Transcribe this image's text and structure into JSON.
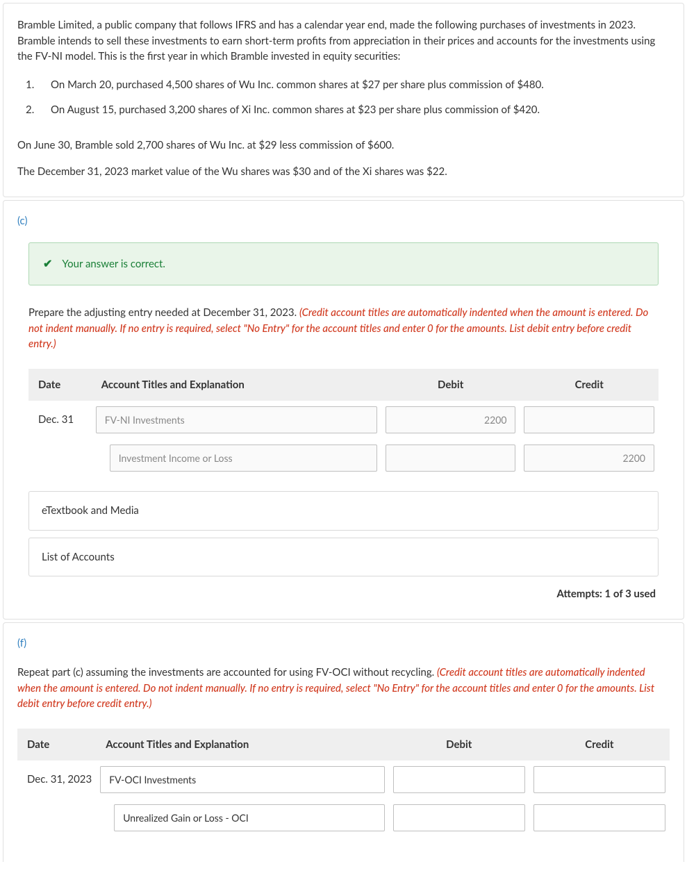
{
  "intro": {
    "p1": "Bramble Limited, a public company that follows IFRS and has a calendar year end, made the following purchases of investments in 2023. Bramble intends to sell these investments to earn short-term profits from appreciation in their prices and accounts for the investments using the FV-NI model. This is the first year in which Bramble invested in equity securities:",
    "list": [
      {
        "n": "1.",
        "t": "On March 20, purchased 4,500 shares of Wu Inc. common shares at $27 per share plus commission of $480."
      },
      {
        "n": "2.",
        "t": "On August 15, purchased 3,200 shares of Xi Inc. common shares at $23 per share plus commission of $420."
      }
    ],
    "p2": "On June 30, Bramble sold 2,700 shares of Wu Inc. at $29 less commission of $600.",
    "p3": "The December 31, 2023 market value of the Wu shares was $30 and of the Xi shares was $22."
  },
  "c": {
    "label": "(c)",
    "banner_text": "Your answer is correct.",
    "instr_lead": "Prepare the adjusting entry needed at December 31, 2023. ",
    "instr_note": "(Credit account titles are automatically indented when the amount is entered. Do not indent manually. If no entry is required, select \"No Entry\" for the account titles and enter 0 for the amounts. List debit entry before credit entry.)",
    "headers": {
      "date": "Date",
      "acct": "Account Titles and Explanation",
      "debit": "Debit",
      "credit": "Credit"
    },
    "rows": [
      {
        "date": "Dec. 31",
        "acct": "FV-NI Investments",
        "debit": "2200",
        "credit": ""
      },
      {
        "date": "",
        "acct": "Investment Income or Loss",
        "debit": "",
        "credit": "2200"
      }
    ],
    "etextbook": "eTextbook and Media",
    "loa": "List of Accounts",
    "attempts": "Attempts: 1 of 3 used"
  },
  "f": {
    "label": "(f)",
    "instr_lead": "Repeat part (c) assuming the investments are accounted for using FV-OCI without recycling. ",
    "instr_note": "(Credit account titles are automatically indented when the amount is entered. Do not indent manually. If no entry is required, select \"No Entry\" for the account titles and enter 0 for the amounts. List debit entry before credit entry.)",
    "headers": {
      "date": "Date",
      "acct": "Account Titles and Explanation",
      "debit": "Debit",
      "credit": "Credit"
    },
    "rows": [
      {
        "date": "Dec. 31, 2023",
        "acct": "FV-OCI Investments",
        "debit": "",
        "credit": ""
      },
      {
        "date": "",
        "acct": "Unrealized Gain or Loss - OCI",
        "debit": "",
        "credit": ""
      }
    ]
  }
}
